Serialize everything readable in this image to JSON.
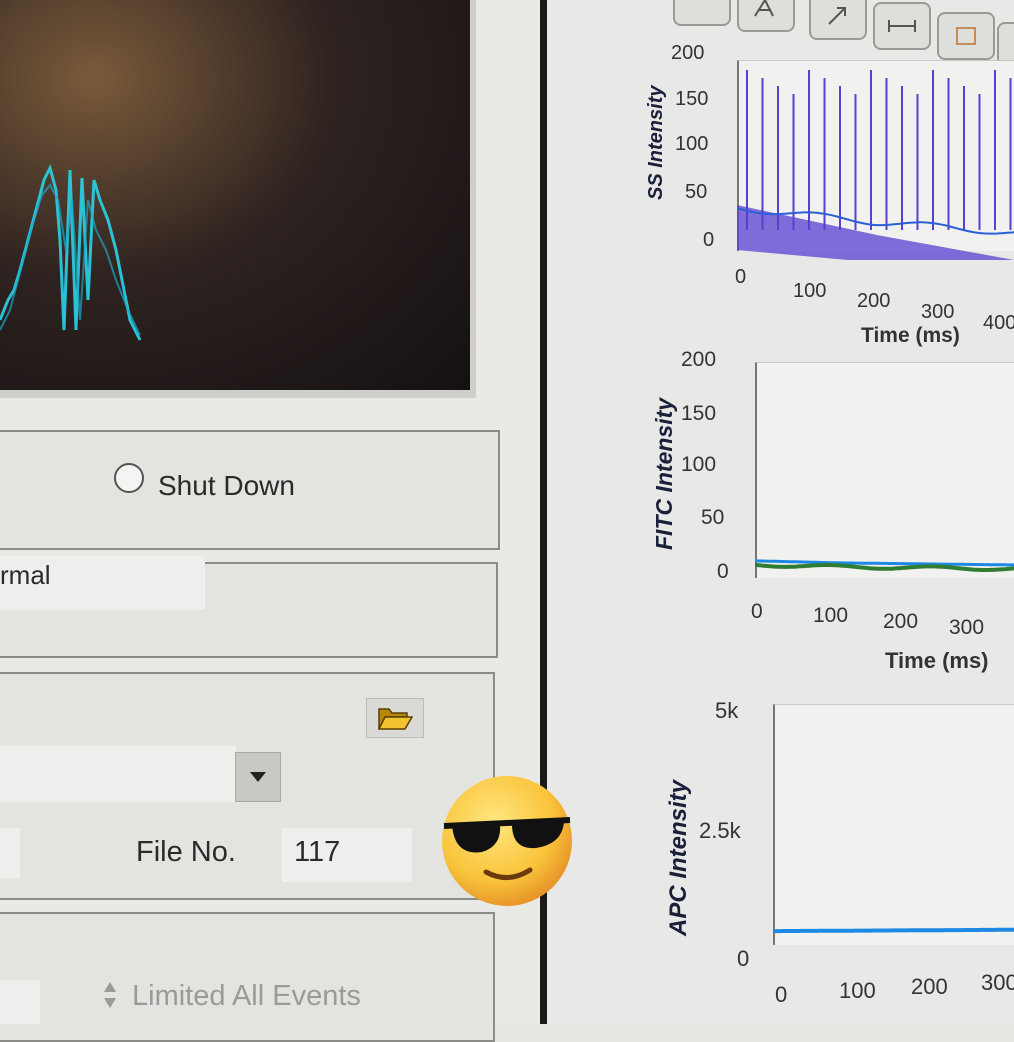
{
  "controls": {
    "shutdown_label": "Shut Down",
    "mode_value": "rmal",
    "file_no_label": "File No.",
    "file_no_value": "117",
    "events_option": "Limited All Events"
  },
  "icons": {
    "folder": "folder-open-icon",
    "dropdown": "triangle-down-icon",
    "emoji": "sunglasses-smiley-icon"
  },
  "colors": {
    "ss_trace": "#5a3fd0",
    "fitc_trace": "#2e7d32",
    "fitc_baseline": "#1e88e5",
    "apc_trace": "#1e88e5",
    "scope_trace": "#29d3ea"
  },
  "chart_data": [
    {
      "type": "line",
      "title": "",
      "ylabel": "SS Intensity",
      "xlabel": "Time (ms)",
      "yticks": [
        "200",
        "150",
        "100",
        "50",
        "0"
      ],
      "xticks": [
        "0",
        "100",
        "200",
        "300",
        "400"
      ],
      "ylim": [
        0,
        200
      ],
      "series": [
        {
          "values": [
            45,
            38,
            30,
            25,
            18
          ]
        }
      ]
    },
    {
      "type": "line",
      "title": "",
      "ylabel": "FITC Intensity",
      "xlabel": "Time (ms)",
      "yticks": [
        "200",
        "150",
        "100",
        "50",
        "0"
      ],
      "xticks": [
        "0",
        "100",
        "200",
        "300"
      ],
      "ylim": [
        0,
        200
      ],
      "series": [
        {
          "values": [
            8,
            6,
            5,
            4
          ]
        }
      ]
    },
    {
      "type": "line",
      "title": "",
      "ylabel": "APC Intensity",
      "xlabel": "",
      "yticks": [
        "5k",
        "2.5k",
        "0"
      ],
      "xticks": [
        "0",
        "100",
        "200",
        "300"
      ],
      "ylim": [
        0,
        5000
      ],
      "series": [
        {
          "values": [
            20,
            30,
            40,
            50
          ]
        }
      ]
    }
  ]
}
